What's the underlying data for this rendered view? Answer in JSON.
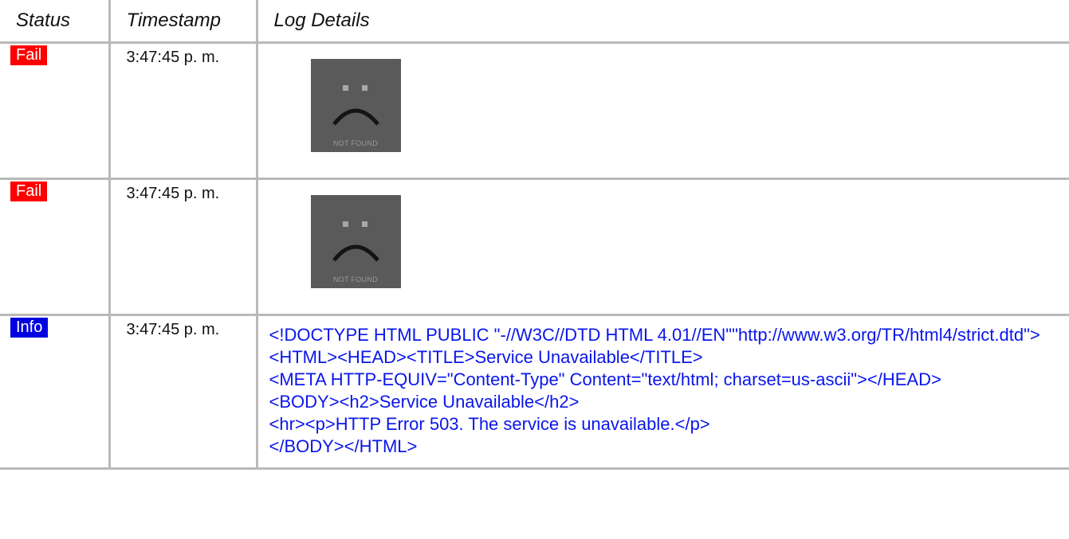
{
  "headers": {
    "status": "Status",
    "timestamp": "Timestamp",
    "details": "Log Details"
  },
  "colors": {
    "fail": "#ff0000",
    "info": "#0000e0",
    "code_text": "#0a16ea",
    "grid": "#b9b9b9"
  },
  "rows": [
    {
      "status": "Fail",
      "timestamp": "3:47:45 p. m.",
      "image": {
        "icon": "sad-face-icon",
        "caption": "NOT FOUND"
      }
    },
    {
      "status": "Fail",
      "timestamp": "3:47:45 p. m.",
      "image": {
        "icon": "sad-face-icon",
        "caption": "NOT FOUND"
      }
    },
    {
      "status": "Info",
      "timestamp": "3:47:45 p. m.",
      "text": "<!DOCTYPE HTML PUBLIC \"-//W3C//DTD HTML 4.01//EN\"\"http://www.w3.org/TR/html4/strict.dtd\">\n<HTML><HEAD><TITLE>Service Unavailable</TITLE>\n<META HTTP-EQUIV=\"Content-Type\" Content=\"text/html; charset=us-ascii\"></HEAD>\n<BODY><h2>Service Unavailable</h2>\n<hr><p>HTTP Error 503. The service is unavailable.</p>\n</BODY></HTML>"
    }
  ]
}
